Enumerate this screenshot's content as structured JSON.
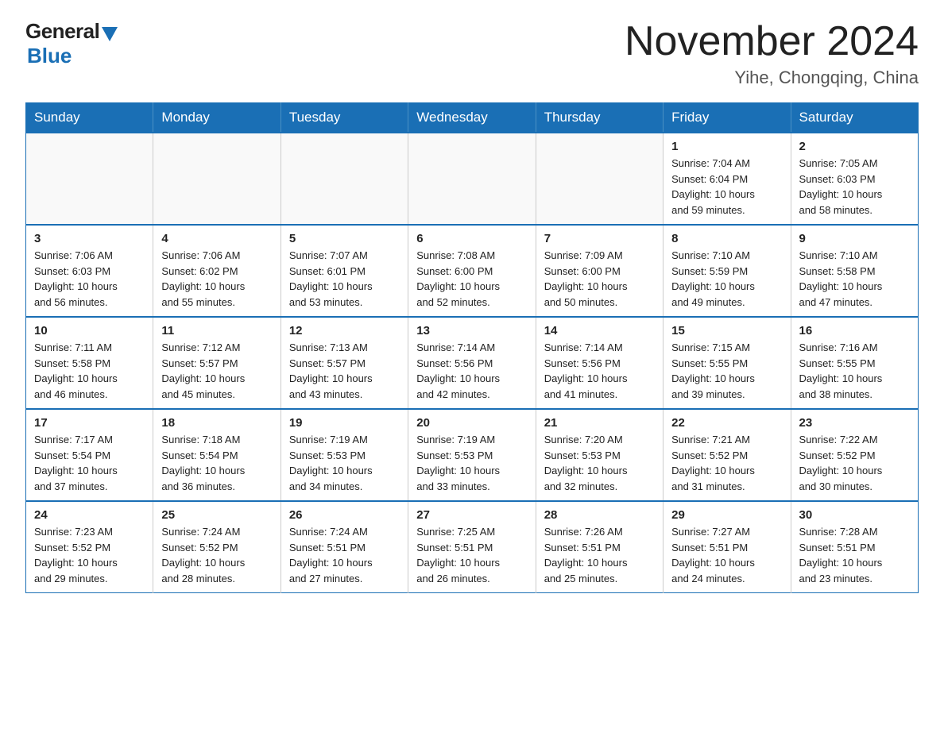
{
  "header": {
    "logo_general": "General",
    "logo_blue": "Blue",
    "month_year": "November 2024",
    "location": "Yihe, Chongqing, China"
  },
  "weekdays": [
    "Sunday",
    "Monday",
    "Tuesday",
    "Wednesday",
    "Thursday",
    "Friday",
    "Saturday"
  ],
  "weeks": [
    [
      {
        "day": "",
        "info": ""
      },
      {
        "day": "",
        "info": ""
      },
      {
        "day": "",
        "info": ""
      },
      {
        "day": "",
        "info": ""
      },
      {
        "day": "",
        "info": ""
      },
      {
        "day": "1",
        "info": "Sunrise: 7:04 AM\nSunset: 6:04 PM\nDaylight: 10 hours\nand 59 minutes."
      },
      {
        "day": "2",
        "info": "Sunrise: 7:05 AM\nSunset: 6:03 PM\nDaylight: 10 hours\nand 58 minutes."
      }
    ],
    [
      {
        "day": "3",
        "info": "Sunrise: 7:06 AM\nSunset: 6:03 PM\nDaylight: 10 hours\nand 56 minutes."
      },
      {
        "day": "4",
        "info": "Sunrise: 7:06 AM\nSunset: 6:02 PM\nDaylight: 10 hours\nand 55 minutes."
      },
      {
        "day": "5",
        "info": "Sunrise: 7:07 AM\nSunset: 6:01 PM\nDaylight: 10 hours\nand 53 minutes."
      },
      {
        "day": "6",
        "info": "Sunrise: 7:08 AM\nSunset: 6:00 PM\nDaylight: 10 hours\nand 52 minutes."
      },
      {
        "day": "7",
        "info": "Sunrise: 7:09 AM\nSunset: 6:00 PM\nDaylight: 10 hours\nand 50 minutes."
      },
      {
        "day": "8",
        "info": "Sunrise: 7:10 AM\nSunset: 5:59 PM\nDaylight: 10 hours\nand 49 minutes."
      },
      {
        "day": "9",
        "info": "Sunrise: 7:10 AM\nSunset: 5:58 PM\nDaylight: 10 hours\nand 47 minutes."
      }
    ],
    [
      {
        "day": "10",
        "info": "Sunrise: 7:11 AM\nSunset: 5:58 PM\nDaylight: 10 hours\nand 46 minutes."
      },
      {
        "day": "11",
        "info": "Sunrise: 7:12 AM\nSunset: 5:57 PM\nDaylight: 10 hours\nand 45 minutes."
      },
      {
        "day": "12",
        "info": "Sunrise: 7:13 AM\nSunset: 5:57 PM\nDaylight: 10 hours\nand 43 minutes."
      },
      {
        "day": "13",
        "info": "Sunrise: 7:14 AM\nSunset: 5:56 PM\nDaylight: 10 hours\nand 42 minutes."
      },
      {
        "day": "14",
        "info": "Sunrise: 7:14 AM\nSunset: 5:56 PM\nDaylight: 10 hours\nand 41 minutes."
      },
      {
        "day": "15",
        "info": "Sunrise: 7:15 AM\nSunset: 5:55 PM\nDaylight: 10 hours\nand 39 minutes."
      },
      {
        "day": "16",
        "info": "Sunrise: 7:16 AM\nSunset: 5:55 PM\nDaylight: 10 hours\nand 38 minutes."
      }
    ],
    [
      {
        "day": "17",
        "info": "Sunrise: 7:17 AM\nSunset: 5:54 PM\nDaylight: 10 hours\nand 37 minutes."
      },
      {
        "day": "18",
        "info": "Sunrise: 7:18 AM\nSunset: 5:54 PM\nDaylight: 10 hours\nand 36 minutes."
      },
      {
        "day": "19",
        "info": "Sunrise: 7:19 AM\nSunset: 5:53 PM\nDaylight: 10 hours\nand 34 minutes."
      },
      {
        "day": "20",
        "info": "Sunrise: 7:19 AM\nSunset: 5:53 PM\nDaylight: 10 hours\nand 33 minutes."
      },
      {
        "day": "21",
        "info": "Sunrise: 7:20 AM\nSunset: 5:53 PM\nDaylight: 10 hours\nand 32 minutes."
      },
      {
        "day": "22",
        "info": "Sunrise: 7:21 AM\nSunset: 5:52 PM\nDaylight: 10 hours\nand 31 minutes."
      },
      {
        "day": "23",
        "info": "Sunrise: 7:22 AM\nSunset: 5:52 PM\nDaylight: 10 hours\nand 30 minutes."
      }
    ],
    [
      {
        "day": "24",
        "info": "Sunrise: 7:23 AM\nSunset: 5:52 PM\nDaylight: 10 hours\nand 29 minutes."
      },
      {
        "day": "25",
        "info": "Sunrise: 7:24 AM\nSunset: 5:52 PM\nDaylight: 10 hours\nand 28 minutes."
      },
      {
        "day": "26",
        "info": "Sunrise: 7:24 AM\nSunset: 5:51 PM\nDaylight: 10 hours\nand 27 minutes."
      },
      {
        "day": "27",
        "info": "Sunrise: 7:25 AM\nSunset: 5:51 PM\nDaylight: 10 hours\nand 26 minutes."
      },
      {
        "day": "28",
        "info": "Sunrise: 7:26 AM\nSunset: 5:51 PM\nDaylight: 10 hours\nand 25 minutes."
      },
      {
        "day": "29",
        "info": "Sunrise: 7:27 AM\nSunset: 5:51 PM\nDaylight: 10 hours\nand 24 minutes."
      },
      {
        "day": "30",
        "info": "Sunrise: 7:28 AM\nSunset: 5:51 PM\nDaylight: 10 hours\nand 23 minutes."
      }
    ]
  ]
}
